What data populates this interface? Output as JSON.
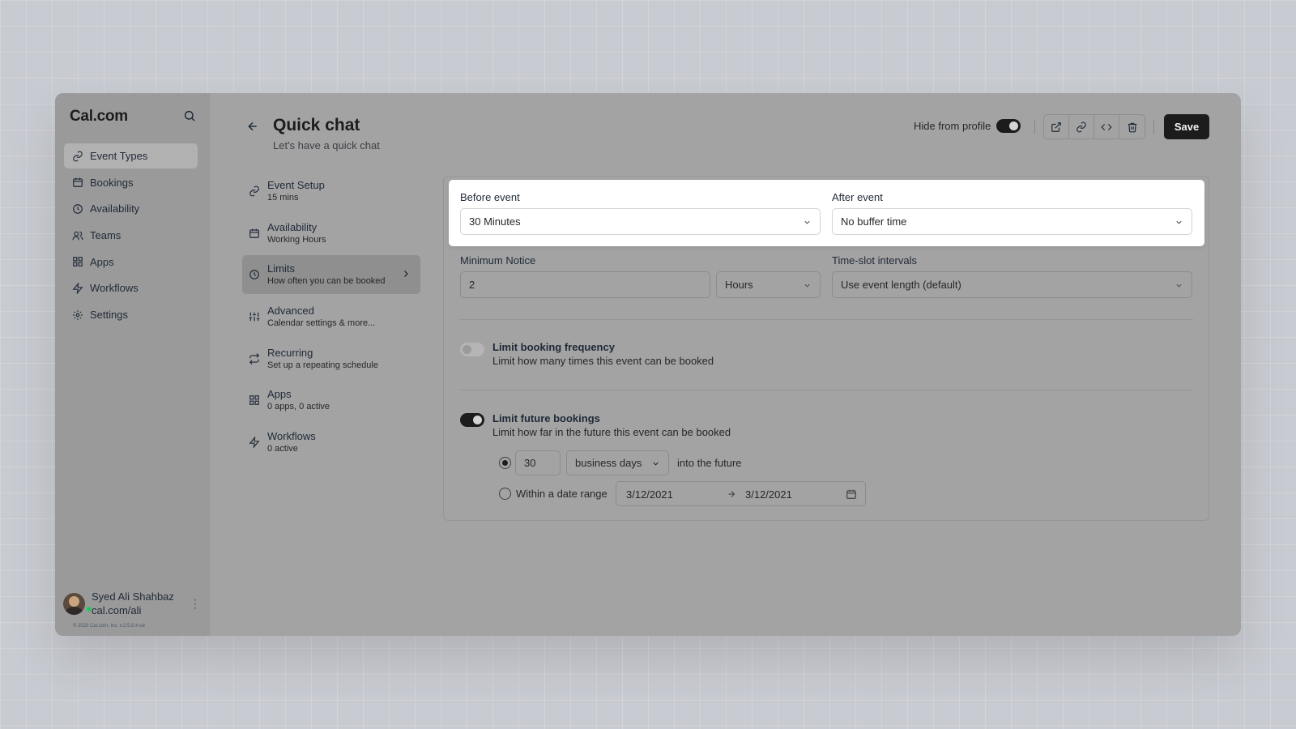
{
  "app": {
    "logo": "Cal.com"
  },
  "sidebar": {
    "items": [
      {
        "label": "Event Types",
        "icon": "link-icon"
      },
      {
        "label": "Bookings",
        "icon": "calendar-icon"
      },
      {
        "label": "Availability",
        "icon": "clock-icon"
      },
      {
        "label": "Teams",
        "icon": "users-icon"
      },
      {
        "label": "Apps",
        "icon": "grid-icon"
      },
      {
        "label": "Workflows",
        "icon": "zap-icon"
      },
      {
        "label": "Settings",
        "icon": "gear-icon"
      }
    ],
    "user": {
      "name": "Syed Ali Shahbaz",
      "url": "cal.com/ali"
    },
    "copyright": "© 2023 Cal.com, Inc. v.2.5.5-h-ce"
  },
  "header": {
    "title": "Quick chat",
    "subtitle": "Let's have a quick chat",
    "hide_from_profile": "Hide from profile",
    "save_label": "Save"
  },
  "subnav": {
    "items": [
      {
        "title": "Event Setup",
        "desc": "15 mins"
      },
      {
        "title": "Availability",
        "desc": "Working Hours"
      },
      {
        "title": "Limits",
        "desc": "How often you can be booked"
      },
      {
        "title": "Advanced",
        "desc": "Calendar settings & more..."
      },
      {
        "title": "Recurring",
        "desc": "Set up a repeating schedule"
      },
      {
        "title": "Apps",
        "desc": "0 apps, 0 active"
      },
      {
        "title": "Workflows",
        "desc": "0 active"
      }
    ]
  },
  "limits": {
    "before_event": {
      "label": "Before event",
      "value": "30 Minutes"
    },
    "after_event": {
      "label": "After event",
      "value": "No buffer time"
    },
    "minimum_notice": {
      "label": "Minimum Notice",
      "value": "2",
      "unit": "Hours"
    },
    "time_slot": {
      "label": "Time-slot intervals",
      "value": "Use event length (default)"
    },
    "booking_frequency": {
      "title": "Limit booking frequency",
      "desc": "Limit how many times this event can be booked",
      "enabled": false
    },
    "future_bookings": {
      "title": "Limit future bookings",
      "desc": "Limit how far in the future this event can be booked",
      "enabled": true,
      "days_value": "30",
      "days_unit": "business days",
      "into_future": "into the future",
      "date_range_label": "Within a date range",
      "start_date": "3/12/2021",
      "end_date": "3/12/2021"
    }
  }
}
